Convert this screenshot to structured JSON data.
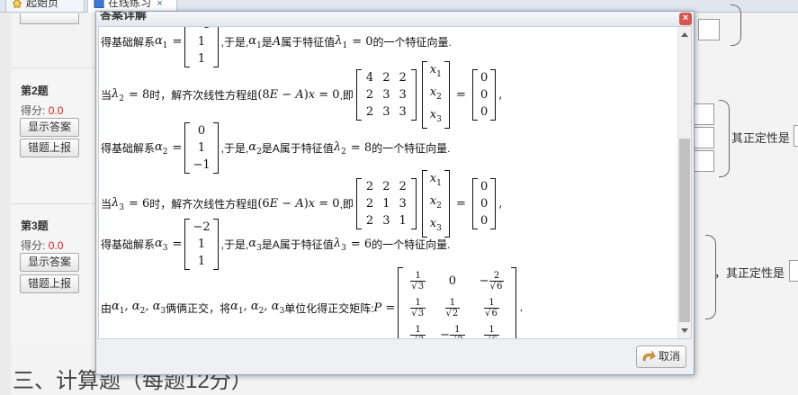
{
  "tabs": [
    {
      "label": "起始页",
      "icon": "home-icon"
    },
    {
      "label": "在线练习",
      "icon": "document-icon",
      "close": "×"
    }
  ],
  "questions": [
    {
      "title": "第2题",
      "score_label": "得分:",
      "score": "0.0",
      "show_answer": "显示答案",
      "report_error": "错题上报"
    },
    {
      "title": "第3题",
      "score_label": "得分:",
      "score": "0.0",
      "show_answer": "显示答案",
      "report_error": "错题上报"
    }
  ],
  "right_text": [
    "其正定性是",
    "，其正定性是"
  ],
  "section_title": "三、计算题（每题12分）",
  "dialog": {
    "title": "答案详解",
    "close": "×",
    "cancel": "取消",
    "lines": {
      "l1_pre": "得基础解系",
      "l1_mid": ",于是,",
      "l1_txt": "是",
      "l1_txt2": "属于特征值",
      "l1_post": "的一个特征向量.",
      "l2_pre": "当",
      "l2_mid": "时，解齐次线性方程组",
      "l2_ji": ",即",
      "l3_pre": "得基础解系",
      "l3_mid": ",于是,",
      "l3_txt": "是A属于特征值",
      "l3_post": "的一个特征向量.",
      "l4_pre": "当",
      "l4_mid": "时，解齐次线性方程组",
      "l4_ji": ",即",
      "l5_pre": "得基础解系",
      "l5_mid": ",于是,",
      "l5_txt": "是A属于特征值",
      "l5_post": "的一个特征向量.",
      "l6_pre": "由",
      "l6_mid": "俩俩正交，将",
      "l6_post": "单位化得正交矩阵:"
    }
  }
}
